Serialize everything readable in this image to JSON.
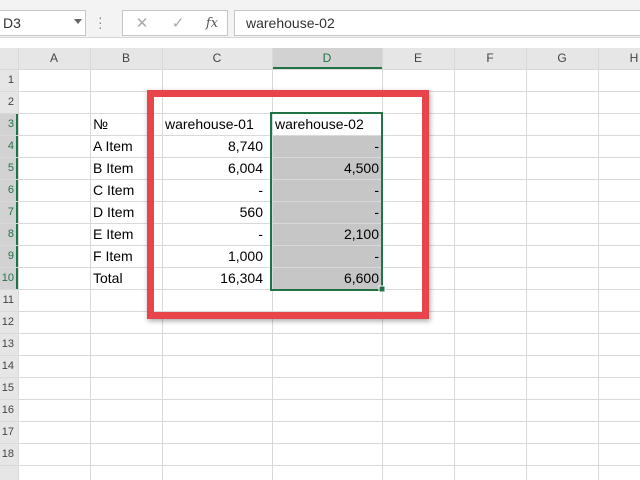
{
  "name_box": "D3",
  "formula_bar": {
    "cancel_icon": "✕",
    "enter_icon": "✓",
    "fx_label": "fx",
    "content": "warehouse-02"
  },
  "columns": [
    "A",
    "B",
    "C",
    "D",
    "E",
    "F",
    "G",
    "H"
  ],
  "rows": [
    "1",
    "2",
    "3",
    "4",
    "5",
    "6",
    "7",
    "8",
    "9",
    "10",
    "11",
    "12",
    "13",
    "14",
    "15",
    "16",
    "17",
    "18"
  ],
  "selected_column": "D",
  "selected_rows": [
    "3",
    "4",
    "5",
    "6",
    "7",
    "8",
    "9",
    "10"
  ],
  "table": {
    "header": {
      "label": "№",
      "c": "warehouse-01",
      "d": "warehouse-02"
    },
    "rows": [
      {
        "label": "A Item",
        "c": "8,740",
        "d": "-"
      },
      {
        "label": "B Item",
        "c": "6,004",
        "d": "4,500"
      },
      {
        "label": "C Item",
        "c": "-",
        "d": "-"
      },
      {
        "label": "D Item",
        "c": "560",
        "d": "-"
      },
      {
        "label": "E Item",
        "c": "-",
        "d": "2,100"
      },
      {
        "label": "F Item",
        "c": "1,000",
        "d": "-"
      }
    ],
    "total": {
      "label": "Total",
      "c": "16,304",
      "d": "6,600"
    }
  },
  "colors": {
    "highlight": "#e8454a",
    "selection_fill": "#c6c6c6",
    "selection_border": "#217346"
  }
}
